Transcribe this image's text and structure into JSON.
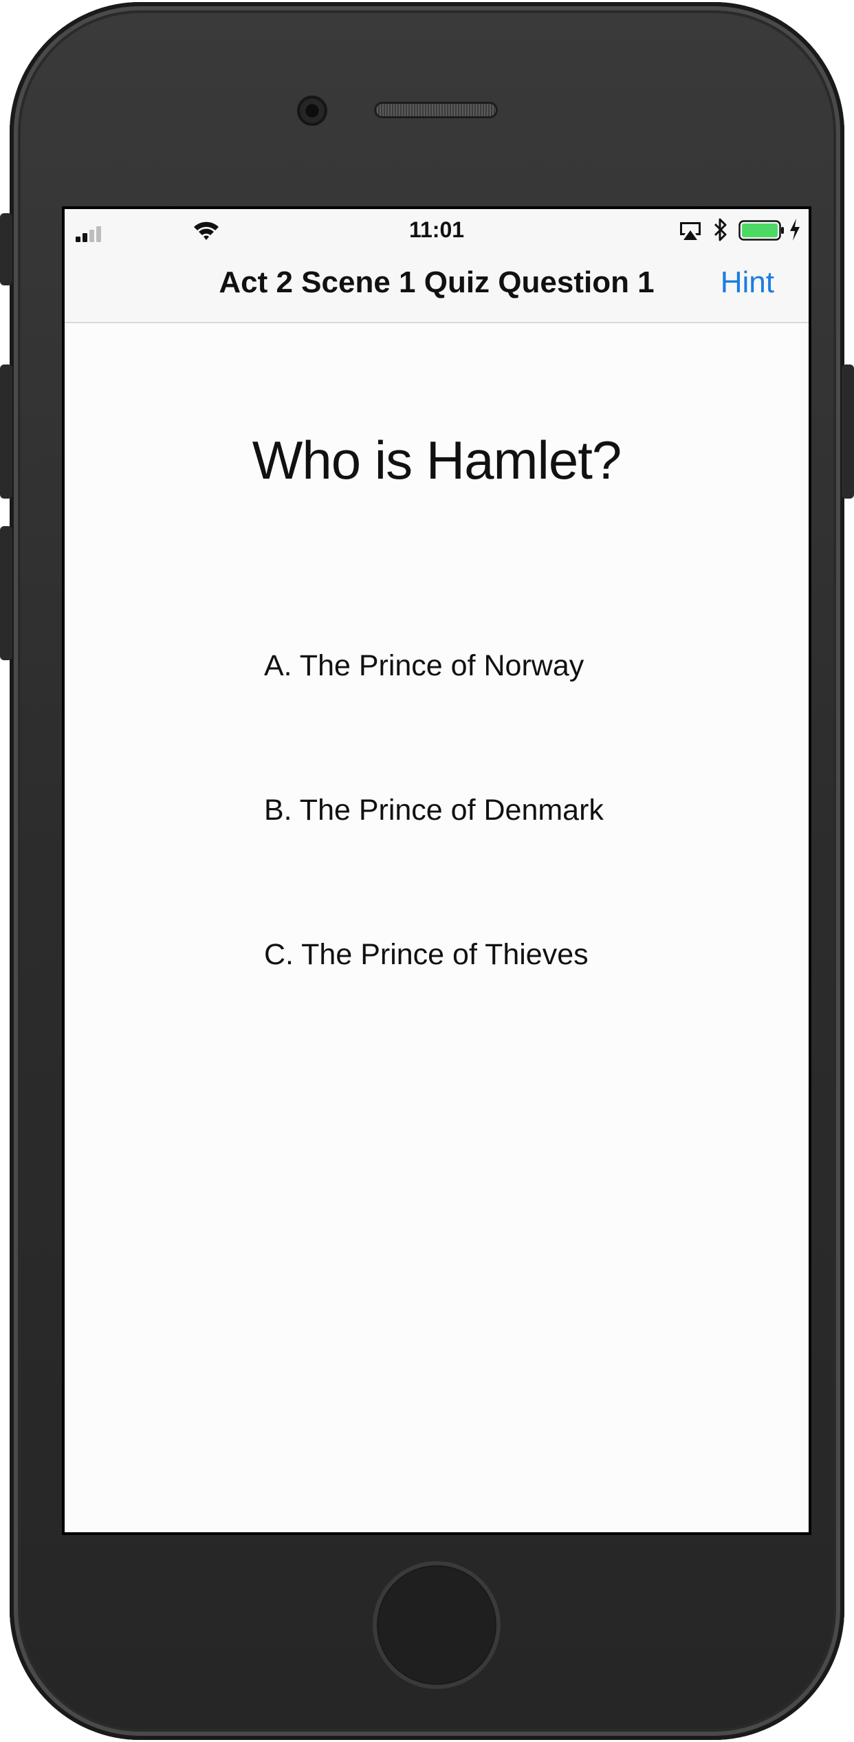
{
  "status_bar": {
    "time": "11:01",
    "icons": [
      "signal-icon",
      "wifi-icon",
      "airplay-icon",
      "bluetooth-icon",
      "battery-icon",
      "charging-icon"
    ],
    "battery_color": "#4cd964"
  },
  "nav": {
    "title": "Act 2 Scene 1 Quiz Question 1",
    "hint_label": "Hint",
    "accent_color": "#1a7de0"
  },
  "quiz": {
    "question": "Who is Hamlet?",
    "answers": [
      "A. The Prince of Norway",
      "B. The Prince of Denmark",
      "C. The Prince of Thieves"
    ]
  }
}
